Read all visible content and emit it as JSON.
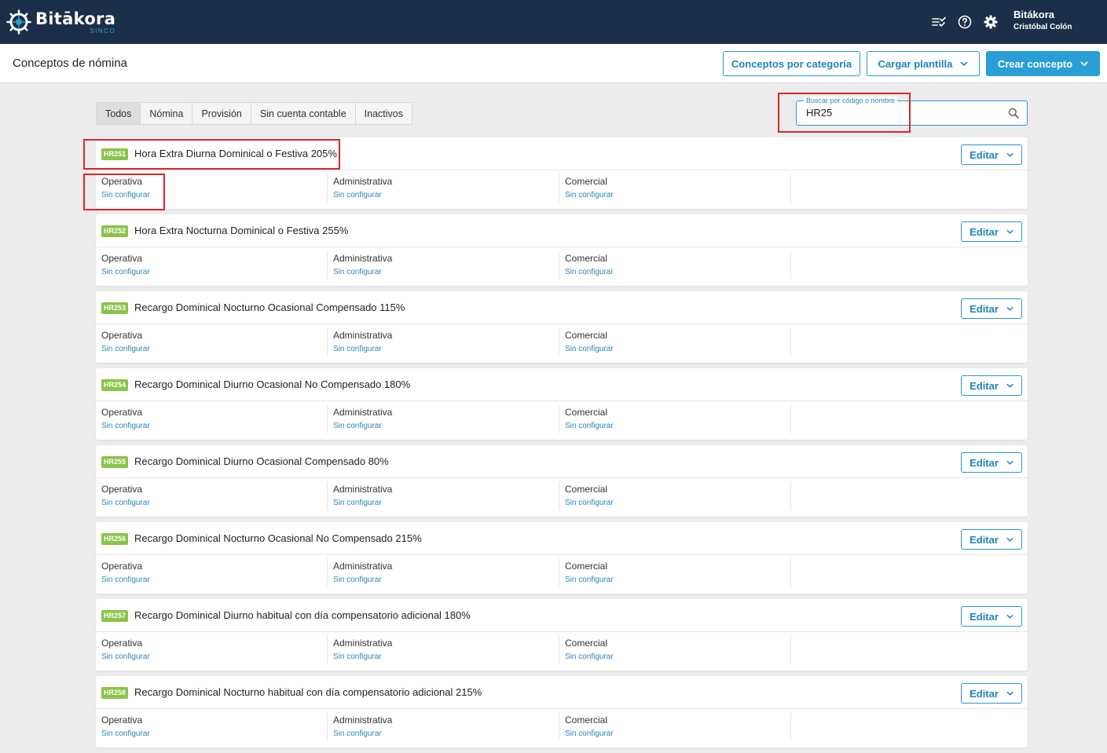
{
  "app": {
    "name": "Bitākora",
    "sub": "SINCO"
  },
  "user": {
    "company": "Bitákora",
    "name": "Cristóbal Colón"
  },
  "topbar_icons": [
    "checklist-icon",
    "help-icon",
    "gear-icon"
  ],
  "page": {
    "title": "Conceptos de nómina"
  },
  "header_buttons": {
    "by_category": "Conceptos por categoría",
    "load_template": "Cargar plantilla",
    "create": "Crear concepto"
  },
  "tabs": [
    "Todos",
    "Nómina",
    "Provisión",
    "Sin cuenta contable",
    "Inactivos"
  ],
  "active_tab": "Todos",
  "search": {
    "label": "Buscar por código o nombre",
    "value": "HR25"
  },
  "edit_label": "Editar",
  "columns": [
    "Operativa",
    "Administrativa",
    "Comercial"
  ],
  "status_label": "Sin configurar",
  "concepts": [
    {
      "code": "HR251",
      "name": "Hora Extra Diurna Dominical o Festiva 205%"
    },
    {
      "code": "HR252",
      "name": "Hora Extra Nocturna Dominical o Festiva 255%"
    },
    {
      "code": "HR253",
      "name": "Recargo Dominical Nocturno Ocasional Compensado 115%"
    },
    {
      "code": "HR254",
      "name": "Recargo Dominical Diurno Ocasional No Compensado 180%"
    },
    {
      "code": "HR255",
      "name": "Recargo Dominical Diurno Ocasional Compensado 80%"
    },
    {
      "code": "HR256",
      "name": "Recargo Dominical Nocturno Ocasional No Compensado 215%"
    },
    {
      "code": "HR257",
      "name": "Recargo Dominical Diurno habitual con día compensatorio adicional 180%"
    },
    {
      "code": "HR258",
      "name": "Recargo Dominical Nocturno habitual con día compensatorio adicional 215%"
    }
  ],
  "colors": {
    "topbar": "#1c2f48",
    "accent": "#2a9fd6",
    "badge": "#8bc34a",
    "highlight": "#e0222a"
  }
}
